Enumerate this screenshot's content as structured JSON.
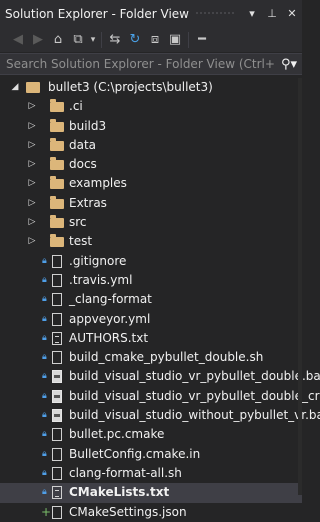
{
  "titlebar": {
    "title": "Solution Explorer - Folder View",
    "dropdown_icon": "▾",
    "pin_icon": "ᵖ",
    "close_icon": "✕"
  },
  "toolbar": {
    "items": [
      "back-icon",
      "forward-icon",
      "home-icon",
      "switch-views-icon",
      "sync-icon",
      "refresh-icon",
      "collapse-all-icon",
      "show-all-files-icon",
      "properties-icon"
    ]
  },
  "search": {
    "placeholder": "Search Solution Explorer - Folder View (Ctrl+;)"
  },
  "tree": {
    "root": "bullet3 (C:\\projects\\bullet3)",
    "folders": [
      ".ci",
      "build3",
      "data",
      "docs",
      "examples",
      "Extras",
      "src",
      "test"
    ],
    "files": [
      {
        "name": ".gitignore",
        "kind": "file"
      },
      {
        "name": ".travis.yml",
        "kind": "file"
      },
      {
        "name": "_clang-format",
        "kind": "file"
      },
      {
        "name": "appveyor.yml",
        "kind": "file"
      },
      {
        "name": "AUTHORS.txt",
        "kind": "txt"
      },
      {
        "name": "build_cmake_pybullet_double.sh",
        "kind": "file"
      },
      {
        "name": "build_visual_studio_vr_pybullet_double.ba",
        "kind": "bat"
      },
      {
        "name": "build_visual_studio_vr_pybullet_double_cr",
        "kind": "bat"
      },
      {
        "name": "build_visual_studio_without_pybullet_vr.ba",
        "kind": "bat"
      },
      {
        "name": "bullet.pc.cmake",
        "kind": "file"
      },
      {
        "name": "BulletConfig.cmake.in",
        "kind": "file"
      },
      {
        "name": "clang-format-all.sh",
        "kind": "file"
      },
      {
        "name": "CMakeLists.txt",
        "kind": "txt",
        "selected": true
      },
      {
        "name": "CMakeSettings.json",
        "kind": "file",
        "added": true
      }
    ]
  }
}
